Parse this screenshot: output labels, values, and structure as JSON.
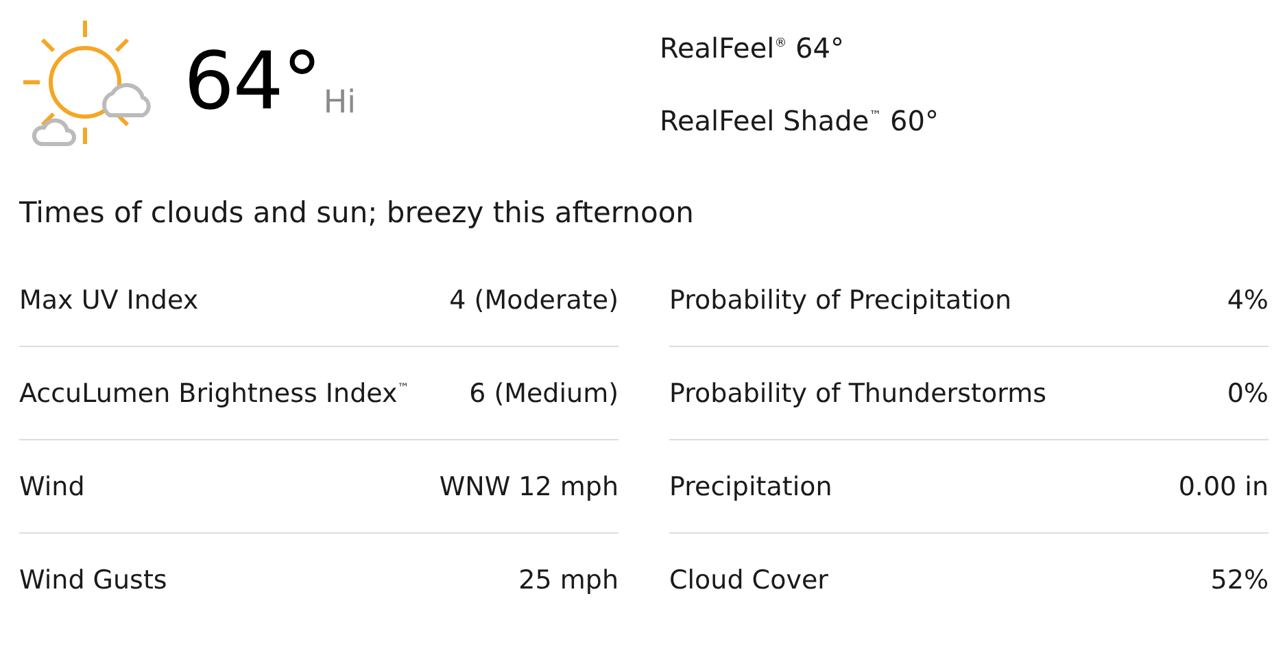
{
  "current": {
    "temperature": "64°",
    "label": "Hi"
  },
  "realfeel": [
    "RealFeel$^{®}$ 64°",
    "RealFeel Shade$^{™}$ 60°"
  ],
  "phrase": "Times of clouds and sun; breezy this afternoon",
  "details": [
    [
      {
        "label": "Max UV Index",
        "value": "4 (Moderate)"
      },
      {
        "label": "AccuLumen Brightness Index$^{™}$",
        "value": "6 (Medium)"
      },
      {
        "label": "Wind",
        "value": "WNW 12 mph"
      },
      {
        "label": "Wind Gusts",
        "value": "25 mph"
      }
    ],
    [
      {
        "label": "Probability of Precipitation",
        "value": "4%"
      },
      {
        "label": "Probability of Thunderstorms",
        "value": "0%"
      },
      {
        "label": "Precipitation",
        "value": "0.00 in"
      },
      {
        "label": "Cloud Cover",
        "value": "52%"
      }
    ]
  ]
}
